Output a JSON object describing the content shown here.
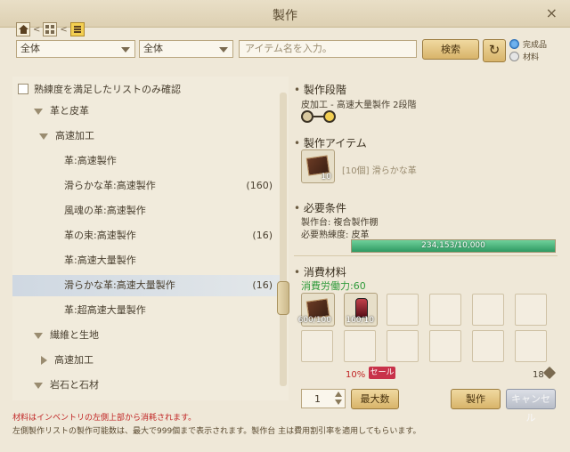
{
  "window": {
    "title": "製作",
    "close_label": "×"
  },
  "breadcrumb": {
    "sep1": "<",
    "sep2": "<"
  },
  "filters": {
    "category1": "全体",
    "category2": "全体",
    "search_placeholder": "アイテム名を入力。",
    "search_button": "検索",
    "refresh_glyph": "↻",
    "radio_finished": "完成品",
    "radio_material": "材料"
  },
  "list": {
    "filter_checkbox_label": "熟練度を満足したリストのみ確認",
    "rows": [
      {
        "label": "革と皮革",
        "count": ""
      },
      {
        "label": "高速加工",
        "count": ""
      },
      {
        "label": "革:高速製作",
        "count": ""
      },
      {
        "label": "滑らかな革:高速製作",
        "count": "(160)"
      },
      {
        "label": "風魂の革:高速製作",
        "count": ""
      },
      {
        "label": "革の束:高速製作",
        "count": "(16)"
      },
      {
        "label": "革:高速大量製作",
        "count": ""
      },
      {
        "label": "滑らかな革:高速大量製作",
        "count": "(16)"
      },
      {
        "label": "革:超高速大量製作",
        "count": ""
      },
      {
        "label": "繊維と生地",
        "count": ""
      },
      {
        "label": "高速加工",
        "count": ""
      },
      {
        "label": "岩石と石材",
        "count": ""
      }
    ]
  },
  "detail": {
    "stage_heading": "製作段階",
    "stage_text": "皮加工 - 高速大量製作 2段階",
    "item_heading": "製作アイテム",
    "item_text": "[10個] 滑らかな革",
    "item_qty": "10",
    "req_heading": "必要条件",
    "req_station": "製作台: 複合製作棚",
    "req_skill": "必要熟練度: 皮革",
    "progress_text": "234,153/10,000",
    "progress_fraction": 1.0,
    "mat_heading": "消費材料",
    "labor_text": "消費労働力:60",
    "materials": [
      {
        "qty": "600/100"
      },
      {
        "qty": "160/10"
      }
    ],
    "discount_pct": "10%",
    "sale_badge": "セール",
    "cost_value": "18"
  },
  "actions": {
    "quantity": "1",
    "max_button": "最大数",
    "craft_button": "製作",
    "cancel_button": "キャンセル"
  },
  "footer": {
    "note1": "材料はインベントリの左側上部から消耗されます。",
    "note2": "左側製作リストの製作可能数は、最大で999個まで表示されます。製作台 主は費用割引率を適用してもらいます。"
  },
  "colors": {
    "accent_gold": "#f3cf52",
    "progress_green": "#2f9a63",
    "labor_green": "#2f9a3a",
    "warning_red": "#c02424",
    "selected_row": "#cfd8e2"
  }
}
